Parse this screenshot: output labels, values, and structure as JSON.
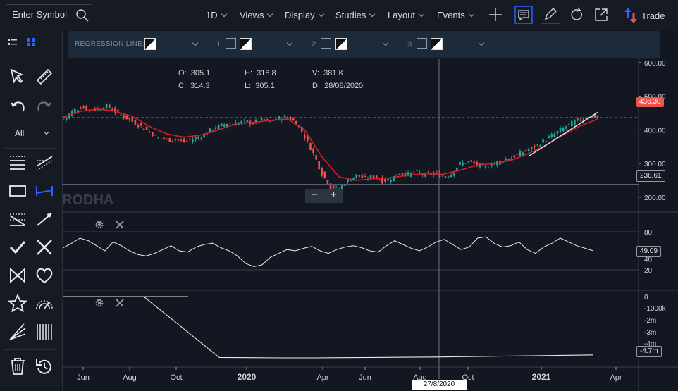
{
  "toolbar": {
    "search_placeholder": "Enter Symbol",
    "menus": [
      "1D",
      "Views",
      "Display",
      "Studies",
      "Layout",
      "Events"
    ],
    "trade_label": "Trade",
    "icons": [
      "search-icon",
      "crosshair-icon",
      "chart-notes-icon",
      "pen-icon",
      "reset-icon",
      "popout-icon",
      "trade-arrows-icon"
    ]
  },
  "tools": {
    "all_label": "All"
  },
  "regression": {
    "label": "REGRESSION LINE:",
    "lines": [
      "1",
      "2",
      "3"
    ]
  },
  "ohlc": {
    "O": "305.1",
    "H": "318.8",
    "V": "381 K",
    "C": "314.3",
    "L": "305.1",
    "D": "28/08/2020"
  },
  "watermark": "RODHA",
  "price_tags": {
    "last": "436.30",
    "level": "238.61",
    "rsi": "49.09",
    "obv": "-4.7m"
  },
  "date_tag": "27/8/2020",
  "colors": {
    "bg": "#131722",
    "up": "#26a69a",
    "down": "#ef5350",
    "ma": "#d11f2b",
    "accent": "#2962ff"
  },
  "chart_data": [
    {
      "type": "candlestick",
      "title": "",
      "y_ticks": [
        "600.00",
        "500.00",
        "400.00",
        "300.00",
        "200.00"
      ],
      "x_ticks": [
        "Jun",
        "Aug",
        "Oct",
        "2020",
        "Apr",
        "Jun",
        "Aug",
        "Oct",
        "2021",
        "Apr"
      ],
      "ylim": [
        160,
        610
      ],
      "close_series": [
        [
          0,
          430
        ],
        [
          3,
          455
        ],
        [
          6,
          468
        ],
        [
          9,
          458
        ],
        [
          12,
          462
        ],
        [
          15,
          470
        ],
        [
          18,
          455
        ],
        [
          21,
          440
        ],
        [
          24,
          425
        ],
        [
          27,
          410
        ],
        [
          30,
          395
        ],
        [
          33,
          375
        ],
        [
          36,
          370
        ],
        [
          39,
          372
        ],
        [
          42,
          365
        ],
        [
          45,
          372
        ],
        [
          48,
          382
        ],
        [
          51,
          398
        ],
        [
          54,
          410
        ],
        [
          57,
          420
        ],
        [
          60,
          418
        ],
        [
          63,
          425
        ],
        [
          66,
          420
        ],
        [
          69,
          430
        ],
        [
          72,
          424
        ],
        [
          75,
          435
        ],
        [
          78,
          438
        ],
        [
          81,
          420
        ],
        [
          84,
          380
        ],
        [
          87,
          330
        ],
        [
          90,
          270
        ],
        [
          93,
          230
        ],
        [
          96,
          225
        ],
        [
          99,
          250
        ],
        [
          102,
          265
        ],
        [
          105,
          255
        ],
        [
          108,
          262
        ],
        [
          111,
          248
        ],
        [
          114,
          255
        ],
        [
          117,
          272
        ],
        [
          120,
          268
        ],
        [
          123,
          275
        ],
        [
          126,
          265
        ],
        [
          129,
          270
        ],
        [
          132,
          262
        ],
        [
          135,
          268
        ],
        [
          138,
          300
        ],
        [
          141,
          305
        ],
        [
          144,
          296
        ],
        [
          147,
          290
        ],
        [
          150,
          300
        ],
        [
          153,
          310
        ],
        [
          156,
          318
        ],
        [
          159,
          330
        ],
        [
          162,
          342
        ],
        [
          165,
          355
        ],
        [
          168,
          372
        ],
        [
          171,
          388
        ],
        [
          174,
          405
        ],
        [
          177,
          420
        ],
        [
          180,
          432
        ],
        [
          183,
          440
        ],
        [
          186,
          438
        ]
      ],
      "moving_average_series": [
        [
          0,
          438
        ],
        [
          6,
          455
        ],
        [
          12,
          462
        ],
        [
          18,
          455
        ],
        [
          24,
          440
        ],
        [
          30,
          410
        ],
        [
          36,
          388
        ],
        [
          42,
          378
        ],
        [
          48,
          385
        ],
        [
          54,
          400
        ],
        [
          60,
          418
        ],
        [
          66,
          422
        ],
        [
          72,
          428
        ],
        [
          78,
          432
        ],
        [
          84,
          400
        ],
        [
          90,
          320
        ],
        [
          96,
          260
        ],
        [
          102,
          250
        ],
        [
          108,
          255
        ],
        [
          114,
          258
        ],
        [
          120,
          265
        ],
        [
          126,
          270
        ],
        [
          132,
          268
        ],
        [
          138,
          280
        ],
        [
          144,
          295
        ],
        [
          150,
          300
        ],
        [
          156,
          310
        ],
        [
          162,
          330
        ],
        [
          168,
          355
        ],
        [
          174,
          385
        ],
        [
          180,
          412
        ],
        [
          186,
          432
        ]
      ],
      "regression_line": [
        [
          162,
          322
        ],
        [
          186,
          452
        ]
      ],
      "horizontal_levels": [
        436.3,
        238.61
      ]
    },
    {
      "type": "line",
      "title": "",
      "y_ticks": [
        "80",
        "40",
        "20"
      ],
      "ylim": [
        0,
        100
      ],
      "series": [
        {
          "values": [
            55,
            62,
            70,
            66,
            58,
            50,
            64,
            58,
            50,
            44,
            42,
            46,
            52,
            58,
            50,
            48,
            56,
            60,
            62,
            55,
            50,
            42,
            30,
            25,
            28,
            40,
            46,
            52,
            50,
            54,
            57,
            50,
            46,
            52,
            56,
            58,
            55,
            50,
            48,
            58,
            66,
            60,
            54,
            50,
            56,
            64,
            68,
            60,
            52,
            56,
            70,
            72,
            62,
            56,
            58,
            64,
            52,
            46,
            56,
            62,
            70,
            64,
            58,
            54,
            50
          ]
        }
      ]
    },
    {
      "type": "line",
      "title": "",
      "y_ticks": [
        "0",
        "-1000k",
        "-2m",
        "-3m",
        "-4m"
      ],
      "series": [
        {
          "values": [
            0,
            0,
            0,
            0,
            0,
            -5.3,
            -5.35,
            -5.4,
            -5.4,
            -5.35,
            -5.3,
            -5.25,
            -5.2,
            -5.1,
            -5.0,
            -4.9,
            -4.8,
            -4.7
          ]
        }
      ]
    }
  ]
}
